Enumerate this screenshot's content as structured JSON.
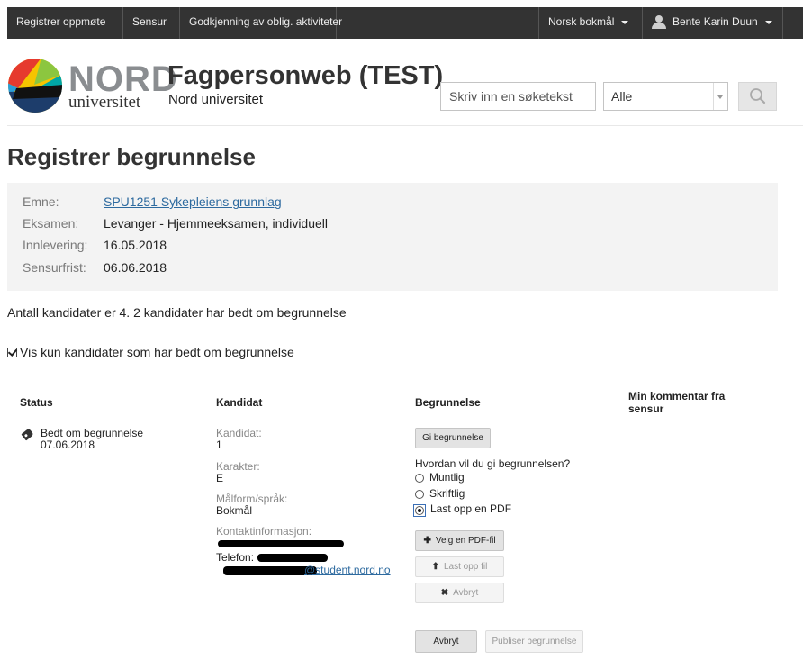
{
  "topnav": {
    "items": [
      "Registrer oppmøte",
      "Sensur",
      "Godkjenning av oblig. aktiviteter"
    ],
    "language": "Norsk bokmål",
    "user": "Bente Karin Duun"
  },
  "header": {
    "logo_word": "NORD",
    "logo_sub": "universitet",
    "title": "Fagpersonweb (TEST)",
    "subtitle": "Nord universitet"
  },
  "search": {
    "placeholder": "Skriv inn en søketekst",
    "scope": "Alle",
    "icon": "search-icon"
  },
  "page": {
    "title": "Registrer begrunnelse",
    "count_text": "Antall kandidater er 4. 2 kandidater har bedt om begrunnelse",
    "filter_label": "Vis kun kandidater som har bedt om begrunnelse",
    "filter_checked": true
  },
  "info": {
    "emne_label": "Emne:",
    "emne": "SPU1251 Sykepleiens grunnlag",
    "eksamen_label": "Eksamen:",
    "eksamen": "Levanger - Hjemmeeksamen, individuell",
    "innlevering_label": "Innlevering:",
    "innlevering": "16.05.2018",
    "sensurfrist_label": "Sensurfrist:",
    "sensurfrist": "06.06.2018"
  },
  "table": {
    "headers": {
      "status": "Status",
      "kandidat": "Kandidat",
      "begrunnelse": "Begrunnelse",
      "kommentar_1": "Min kommentar fra",
      "kommentar_2": "sensur"
    },
    "row": {
      "status": "Bedt om begrunnelse",
      "status_date": "07.06.2018",
      "kandidat_label": "Kandidat:",
      "kandidat": "1",
      "karakter_label": "Karakter:",
      "karakter": "E",
      "malform_label": "Målform/språk:",
      "malform": "Bokmål",
      "kontakt_label": "Kontaktinformasjon:",
      "telefon_label": "Telefon:",
      "email_visible": "@student.nord.no"
    },
    "begrunnelse": {
      "give_button": "Gi begrunnelse",
      "question": "Hvordan vil du gi begrunnelsen?",
      "options": [
        "Muntlig",
        "Skriftlig",
        "Last opp en PDF"
      ],
      "selected_option": "Last opp en PDF",
      "choose_pdf": "Velg en PDF-fil",
      "upload": "Last opp fil",
      "cancel_small": "Avbryt",
      "cancel": "Avbryt",
      "publish": "Publiser begrunnelse"
    }
  },
  "colors": {
    "topbar": "#333333",
    "link": "#2d6a9f",
    "info_bg": "#f3f3f3"
  }
}
